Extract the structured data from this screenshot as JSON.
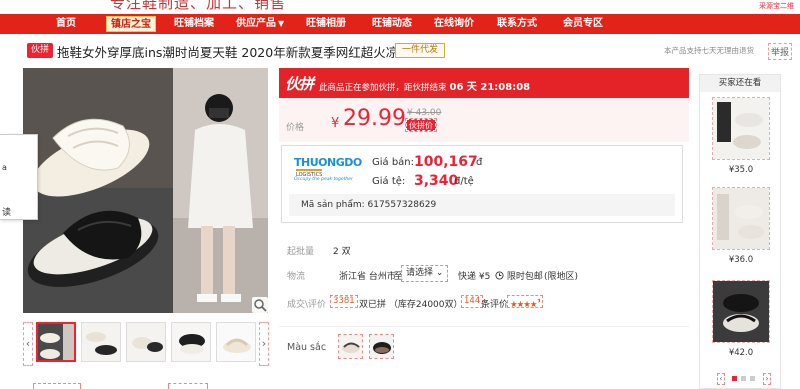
{
  "header": {
    "slogan": "专注鞋制造、加工、销售",
    "top_right": "采源宝二维"
  },
  "nav": {
    "items": [
      "首页",
      "旺铺档案",
      "供应产品",
      "旺铺相册",
      "旺铺动态",
      "在线询价",
      "联系方式",
      "会员专区"
    ],
    "badge": "镇店之宝",
    "dropdown_caret": "▼"
  },
  "title": {
    "tag": "伙拼",
    "text": "拖鞋女外穿厚底ins潮时尚夏天鞋 2020年新款夏季网红超火凉拖",
    "dropship": "一件代发",
    "return_note": "本产品支持七天无理由退货",
    "report": "举报"
  },
  "promo": {
    "logo": "伙拼",
    "text": "此商品正在参加伙拼，距伙拼结束",
    "countdown": "06 天 21:08:08"
  },
  "price": {
    "label": "价格",
    "currency": "¥",
    "value": "29.99",
    "old_price": "¥ 43.00",
    "badge": "伙拼价"
  },
  "vn": {
    "logo_main": "THUONGDO",
    "logo_sub": "LOGISTICS",
    "logo_tag": "Occupy the peak together",
    "sell_label": "Giá bán:",
    "sell_value": "100,167",
    "sell_unit": "đ",
    "rate_label": "Giá tệ:",
    "rate_value": "3,340",
    "rate_unit": "đ/tệ",
    "sku": "Mã sản phẩm: 617557328629"
  },
  "batch": {
    "label": "起批量",
    "value": "2 双"
  },
  "logistics": {
    "label": "物流",
    "origin": "浙江省 台州市",
    "to": "至",
    "select": "请选择",
    "express": "快递 ¥5",
    "limit": "限时包邮",
    "region": "(限地区)"
  },
  "deals": {
    "label": "成交\\评价",
    "sold_count": "3381",
    "sold_text": "双已拼 （库存24000双）",
    "review_count": "144",
    "review_text": "条评价",
    "rating": 4.5
  },
  "color": {
    "label": "Màu sắc"
  },
  "sidebar": {
    "header": "买家还在看",
    "items": [
      {
        "price": "¥35.0"
      },
      {
        "price": "¥36.0"
      },
      {
        "price": "¥42.0"
      }
    ]
  },
  "side_panel": {
    "first": "a",
    "second": "读"
  },
  "icons": {
    "zoom": "magnifier-icon",
    "prev": "chevron-left-icon",
    "next": "chevron-right-icon",
    "clock": "clock-icon",
    "caret": "chevron-down-icon"
  },
  "colors": {
    "brand_red": "#e2231a",
    "price_red": "#e22233",
    "vn_blue": "#1d8fd4",
    "vn_orange": "#f29622"
  }
}
